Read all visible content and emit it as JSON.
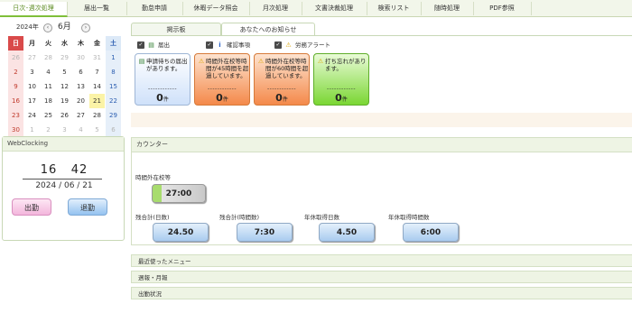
{
  "nav": {
    "tabs": [
      "日次･週次処理",
      "届出一覧",
      "勤怠申請",
      "休暇データ照会",
      "月次処理",
      "文書決裁処理",
      "検索リスト",
      "随時処理",
      "PDF参照"
    ]
  },
  "calendar": {
    "year": "2024年",
    "month": "6月",
    "prev": "‹",
    "next": "›",
    "dow": [
      "日",
      "月",
      "火",
      "水",
      "木",
      "金",
      "土"
    ],
    "weeks": [
      [
        "26",
        "27",
        "28",
        "29",
        "30",
        "31",
        "1"
      ],
      [
        "2",
        "3",
        "4",
        "5",
        "6",
        "7",
        "8"
      ],
      [
        "9",
        "10",
        "11",
        "12",
        "13",
        "14",
        "15"
      ],
      [
        "16",
        "17",
        "18",
        "19",
        "20",
        "21",
        "22"
      ],
      [
        "23",
        "24",
        "25",
        "26",
        "27",
        "28",
        "29"
      ],
      [
        "30",
        "1",
        "2",
        "3",
        "4",
        "5",
        "6"
      ]
    ],
    "today": "21"
  },
  "panel": {
    "tabs": [
      "掲示板",
      "あなたへのお知らせ"
    ],
    "checks": [
      {
        "label": "届出",
        "icon": "document-icon"
      },
      {
        "label": "確認事項",
        "icon": "info-icon"
      },
      {
        "label": "労務アラート",
        "icon": "warning-icon"
      }
    ],
    "check_mark": "✓",
    "cards": [
      {
        "text": "申請待ちの届出があります。",
        "dash": "------------",
        "count": "0",
        "unit": "件",
        "color": "#dbe9fb"
      },
      {
        "text": "時間外在校等時間が45時間を超過しています。",
        "dash": "------------",
        "count": "0",
        "unit": "件",
        "color": "#f6a46c"
      },
      {
        "text": "時間外在校等時間が60時間を超過しています。",
        "dash": "------------",
        "count": "0",
        "unit": "件",
        "color": "#f59a60"
      },
      {
        "text": "打ち忘れがあります。",
        "dash": "------------",
        "count": "0",
        "unit": "件",
        "color": "#8fe04a"
      }
    ]
  },
  "clock": {
    "title": "WebClocking",
    "hour": "16",
    "minute": "42",
    "date": "2024 / 06 / 21",
    "in_label": "出勤",
    "out_label": "退勤"
  },
  "counter": {
    "title": "カウンター",
    "overtime_label": "時間外在校等",
    "overtime_value": "27:00",
    "items": [
      {
        "label": "残合計(日数)",
        "value": "24.50"
      },
      {
        "label": "残合計(時間数)",
        "value": "7:30"
      },
      {
        "label": "年休取得日数",
        "value": "4.50"
      },
      {
        "label": "年休取得時間数",
        "value": "6:00"
      }
    ]
  },
  "sections": [
    "最近使ったメニュー",
    "週報・月報",
    "出勤状況"
  ]
}
